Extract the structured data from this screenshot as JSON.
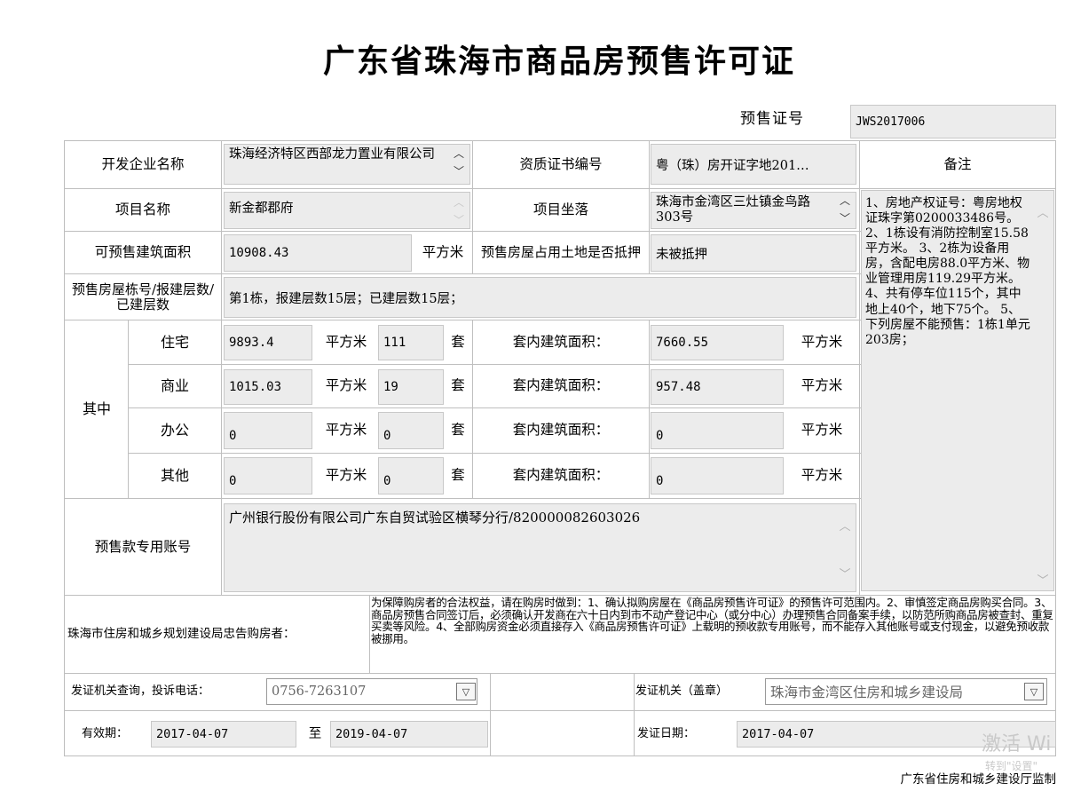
{
  "doc_title": "广东省珠海市商品房预售许可证",
  "permit": {
    "label": "预售证号",
    "value": "JWS2017006"
  },
  "developer": {
    "label": "开发企业名称",
    "value": "珠海经济特区西部龙力置业有限公司"
  },
  "qualification": {
    "label": "资质证书编号",
    "value": "粤（珠）房开证字地201…"
  },
  "remarks": {
    "label": "备注",
    "text": "1、房地产权证号：粤房地权证珠字第0200033486号。 2、1栋设有消防控制室15.58平方米。 3、2栋为设备用房，含配电房88.0平方米、物业管理用房119.29平方米。 4、共有停车位115个，其中地上40个，地下75个。 5、下列房屋不能预售：1栋1单元203房；"
  },
  "project": {
    "name_label": "项目名称",
    "name_value": "新金都郡府",
    "loc_label": "项目坐落",
    "loc_value": "珠海市金湾区三灶镇金鸟路303号"
  },
  "area": {
    "label": "可预售建筑面积",
    "value": "10908.43",
    "unit": "平方米",
    "mortgage_label": "预售房屋占用土地是否抵押",
    "mortgage_value": "未被抵押"
  },
  "building": {
    "label": "预售房屋栋号/报建层数/已建层数",
    "value": "第1栋，报建层数15层；已建层数15层；"
  },
  "breakdown": {
    "label": "其中",
    "unit_area": "平方米",
    "unit_count": "套",
    "inner_label": "套内建筑面积：",
    "rows": [
      {
        "type": "住宅",
        "area": "9893.4",
        "count": "111",
        "inner": "7660.55"
      },
      {
        "type": "商业",
        "area": "1015.03",
        "count": "19",
        "inner": "957.48"
      },
      {
        "type": "办公",
        "area": "0",
        "count": "0",
        "inner": "0"
      },
      {
        "type": "其他",
        "area": "0",
        "count": "0",
        "inner": "0"
      }
    ]
  },
  "account": {
    "label": "预售款专用账号",
    "value": "广州银行股份有限公司广东自贸试验区横琴分行/820000082603026"
  },
  "notice": {
    "label": "珠海市住房和城乡规划建设局忠告购房者：",
    "text": "为保障购房者的合法权益，请在购房时做到：1、确认拟购房屋在《商品房预售许可证》的预售许可范围内。2、审慎签定商品房购买合同。3、商品房预售合同签订后，必须确认开发商在六十日内到市不动产登记中心（或分中心）办理预售合同备案手续，以防范所购商品房被查封、重复买卖等风险。4、全部购房资金必须直接存入《商品房预售许可证》上载明的预收款专用账号，而不能存入其他账号或支付现金，以避免预收款被挪用。"
  },
  "contact": {
    "label": "发证机关查询，投诉电话：",
    "phone": "0756-7263107",
    "issuer_label": "发证机关（盖章）",
    "issuer": "珠海市金湾区住房和城乡建设局"
  },
  "validity": {
    "label": "有效期：",
    "from": "2017-04-07",
    "to_label": "至",
    "to": "2019-04-07",
    "issue_label": "发证日期：",
    "issue_date": "2017-04-07"
  },
  "footer": "广东省住房和城乡建设厅监制",
  "watermark": {
    "line1": "激活 Wi",
    "line2": "转到\"设置\""
  }
}
